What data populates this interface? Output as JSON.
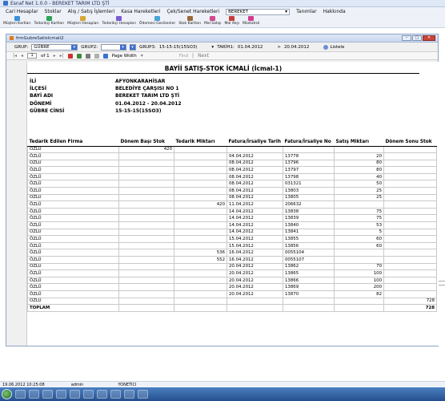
{
  "app": {
    "title": "Esnaf Net 1.0.0 - BEREKET TARIM LTD ŞTİ"
  },
  "menu": {
    "items": [
      "Cari Hesaplar",
      "Stoklar",
      "Alış / Satış İşlemleri",
      "Kasa Hareketleri",
      "Çek/Senet Hareketleri"
    ],
    "company": "BEREKET",
    "tail": [
      "Tanımlar",
      "Hakkında"
    ]
  },
  "toolbar": {
    "items": [
      "Müşteri Kartları",
      "Tedarikçi Kartları",
      "Müşteri Hesapları",
      "Tedarikçi Hesapları",
      "Ödemesi Gecikenler",
      "Stok Kartları",
      "Mal Satışı",
      "Mal Alışı",
      "Müstahsil"
    ]
  },
  "window": {
    "title": "frmGubreSatisIcmali2"
  },
  "filters": {
    "grup1_label": "GRUP:",
    "grup1_value": "GÜBRE",
    "grup2_label": "GRUP2:",
    "grup2_value": "",
    "grup3_label": "GRUP3:",
    "grup3_value": "15-15-15(15SO3)",
    "tarih_label": "TARİH1:",
    "tarih1": "01.04.2012",
    "tarih2_prefix": ">",
    "tarih2": "20.04.2012",
    "list_button": "Listele"
  },
  "report_toolbar": {
    "page": "1",
    "of": "of 1",
    "zoom": "Page Width",
    "find": "Find",
    "next": "Next"
  },
  "report": {
    "title": "BAYİİ SATIŞ-STOK İCMALİ (İcmal-1)",
    "header": [
      {
        "k": "İLİ",
        "v": "AFYONKARAHİSAR"
      },
      {
        "k": "İLÇESİ",
        "v": "BELEDİYE ÇARŞISI NO 1"
      },
      {
        "k": "BAYİ ADI",
        "v": "BEREKET TARIM LTD ŞTİ"
      },
      {
        "k": "DÖNEMİ",
        "v": "01.04.2012 - 20.04.2012"
      },
      {
        "k": "GÜBRE CİNSİ",
        "v": "15-15-15(15SO3)"
      }
    ],
    "columns": [
      "Tedarik Edilen Firma",
      "Dönem Başı Stok",
      "Tedarik Miktarı",
      "Fatura/İrsaliye Tarih",
      "Fatura/İrsaliye No",
      "Satış Miktarı",
      "Dönem Sonu Stok"
    ],
    "rows": [
      [
        "ÖZLÜ",
        "420",
        "",
        "",
        "",
        "",
        ""
      ],
      [
        "ÖZLÜ",
        "",
        "",
        "04.04.2012",
        "13778",
        "20",
        ""
      ],
      [
        "ÖZLÜ",
        "",
        "",
        "08.04.2012",
        "13796",
        "80",
        ""
      ],
      [
        "ÖZLÜ",
        "",
        "",
        "08.04.2012",
        "13797",
        "80",
        ""
      ],
      [
        "ÖZLÜ",
        "",
        "",
        "08.04.2012",
        "13798",
        "40",
        ""
      ],
      [
        "ÖZLÜ",
        "",
        "",
        "08.04.2012",
        "031321",
        "50",
        ""
      ],
      [
        "ÖZLÜ",
        "",
        "",
        "08.04.2012",
        "13803",
        "25",
        ""
      ],
      [
        "ÖZLÜ",
        "",
        "",
        "08.04.2012",
        "13805",
        "25",
        ""
      ],
      [
        "ÖZLÜ",
        "",
        "420",
        "11.04.2012",
        "206632",
        "",
        ""
      ],
      [
        "ÖZLÜ",
        "",
        "",
        "14.04.2012",
        "13838",
        "75",
        ""
      ],
      [
        "ÖZLÜ",
        "",
        "",
        "14.04.2012",
        "13839",
        "75",
        ""
      ],
      [
        "ÖZLÜ",
        "",
        "",
        "14.04.2012",
        "13840",
        "53",
        ""
      ],
      [
        "ÖZLÜ",
        "",
        "",
        "14.04.2012",
        "13841",
        "5",
        ""
      ],
      [
        "ÖZLÜ",
        "",
        "",
        "15.04.2012",
        "13855",
        "60",
        ""
      ],
      [
        "ÖZLÜ",
        "",
        "",
        "15.04.2012",
        "13856",
        "60",
        ""
      ],
      [
        "ÖZLÜ",
        "",
        "536",
        "16.04.2012",
        "0055104",
        "",
        ""
      ],
      [
        "ÖZLÜ",
        "",
        "552",
        "16.04.2012",
        "0055107",
        "",
        ""
      ],
      [
        "ÖZLÜ",
        "",
        "",
        "20.04.2012",
        "13862",
        "70",
        ""
      ],
      [
        "ÖZLÜ",
        "",
        "",
        "20.04.2012",
        "13865",
        "100",
        ""
      ],
      [
        "ÖZLÜ",
        "",
        "",
        "20.04.2012",
        "13866",
        "100",
        ""
      ],
      [
        "ÖZLÜ",
        "",
        "",
        "20.04.2012",
        "13869",
        "200",
        ""
      ],
      [
        "ÖZLÜ",
        "",
        "",
        "20.04.2012",
        "13870",
        "82",
        ""
      ],
      [
        "ÖZLÜ",
        "",
        "",
        "",
        "",
        "",
        "728"
      ]
    ],
    "total_label": "TOPLAM",
    "total_value": "728"
  },
  "status": {
    "datetime": "19.06.2012 10:25:08",
    "user": "admin",
    "role": "YONETICI"
  },
  "colors": {
    "accent": "#3d6fd1",
    "taskbar": "#254f8d"
  }
}
